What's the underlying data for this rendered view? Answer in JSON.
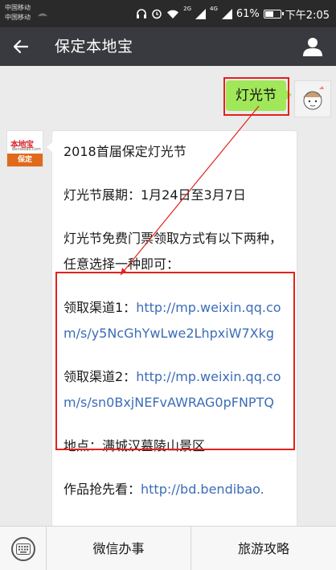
{
  "status_bar": {
    "carrier1": "中国移动",
    "carrier2": "中国移动",
    "battery": "61%",
    "battery_level": 0.61,
    "time": "下午2:05",
    "net_2g": "2G",
    "net_4g": "4G"
  },
  "header": {
    "title": "保定本地宝",
    "back_icon": "arrow-left-icon",
    "profile_icon": "person-icon"
  },
  "chat": {
    "sent_message": "灯光节",
    "bot_avatar": {
      "logo_text": "本地宝",
      "logo_url": "Bendibao.com",
      "logo_city": "保定"
    },
    "received": {
      "line1": "2018首届保定灯光节",
      "line2": "灯光节展期：1月24日至3月7日",
      "line3": "灯光节免费门票领取方式有以下两种，任意选择一种即可：",
      "channel1_label": "领取渠道1：",
      "channel1_link": "http://mp.weixin.qq.com/s/y5NcGhYwLwe2LhpxiW7Xkg",
      "channel2_label": "领取渠道2：",
      "channel2_link": "http://mp.weixin.qq.com/s/sn0BxjNEFvAWRAG0pFNPTQ",
      "location": "地点：满城汉墓陵山景区",
      "preview_label": "作品抢先看：",
      "preview_link": "http://bd.bendibao."
    }
  },
  "bottom_bar": {
    "keyboard_icon": "keyboard-icon",
    "menu1": "微信办事",
    "menu2": "旅游攻略"
  },
  "colors": {
    "header_bg": "#393a3f",
    "sent_bubble": "#a0e75a",
    "link": "#3c6cb8",
    "highlight": "#e2231a"
  }
}
